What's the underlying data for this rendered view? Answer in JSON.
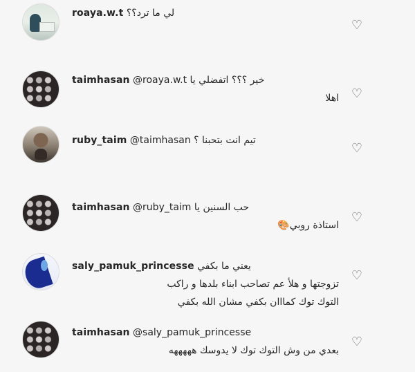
{
  "comments": [
    {
      "username": "roaya.w.t",
      "mention": "",
      "text": "لي ما ترد؟؟",
      "extra_lines": []
    },
    {
      "username": "taimhasan",
      "mention": "@roaya.w.t",
      "text": "خير ؟؟؟ اتفضلي يا",
      "extra_lines": [
        "اهلا"
      ]
    },
    {
      "username": "ruby_taim",
      "mention": "@taimhasan",
      "text": "تيم انت بتحبنا ؟",
      "extra_lines": []
    },
    {
      "username": "taimhasan",
      "mention": "@ruby_taim",
      "text": "حب السنين يا",
      "extra_lines": [
        "استاذة روبي🎨"
      ]
    },
    {
      "username": "saly_pamuk_princesse",
      "mention": "",
      "text": "يعني ما بكفي",
      "extra_lines": [
        "تزوجتها و هلأ عم تصاحب ابناء بلدها و راكب",
        "التوك توك كمااان بكفي مشان الله بكفي"
      ]
    },
    {
      "username": "taimhasan",
      "mention": "@saly_pamuk_princesse",
      "text": "بعدي من وش التوك توك لا يدوسك هههههه",
      "extra_lines": []
    }
  ]
}
